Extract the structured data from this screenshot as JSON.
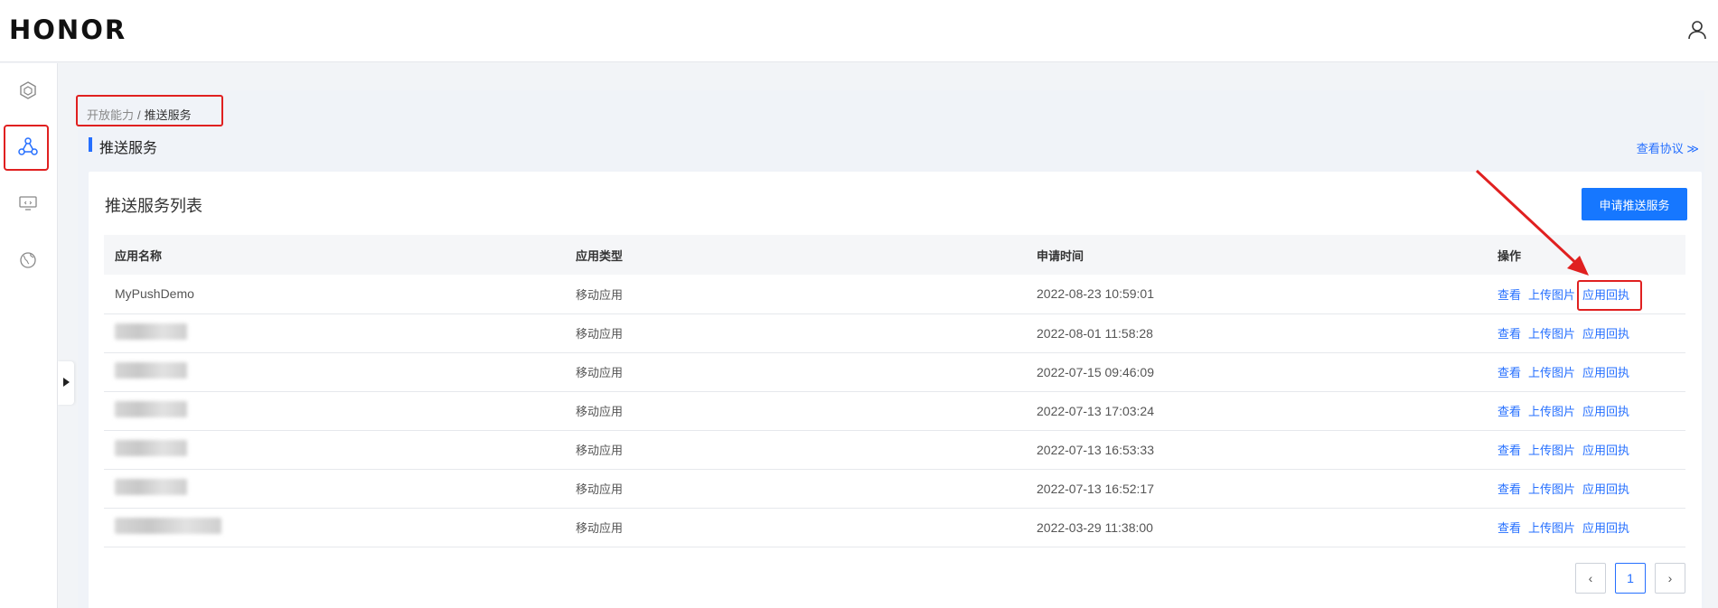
{
  "header": {
    "logo": "HONOR",
    "user_icon": "user-icon"
  },
  "sidebar": {
    "items": [
      {
        "icon": "cube-icon"
      },
      {
        "icon": "network-icon",
        "active": true
      },
      {
        "icon": "monitor-icon"
      },
      {
        "icon": "globe-icon"
      }
    ]
  },
  "breadcrumb": {
    "parent": "开放能力",
    "separator": "/",
    "current": "推送服务"
  },
  "page": {
    "title": "推送服务",
    "view_protocol": "查看协议 ≫"
  },
  "card": {
    "title": "推送服务列表",
    "apply_button": "申请推送服务",
    "columns": [
      "应用名称",
      "应用类型",
      "申请时间",
      "操作"
    ],
    "rows": [
      {
        "name": "MyPushDemo",
        "type": "移动应用",
        "time": "2022-08-23 10:59:01"
      },
      {
        "name": "",
        "type": "移动应用",
        "time": "2022-08-01 11:58:28"
      },
      {
        "name": "",
        "type": "移动应用",
        "time": "2022-07-15 09:46:09"
      },
      {
        "name": "",
        "type": "移动应用",
        "time": "2022-07-13 17:03:24"
      },
      {
        "name": "",
        "type": "移动应用",
        "time": "2022-07-13 16:53:33"
      },
      {
        "name": "",
        "type": "移动应用",
        "time": "2022-07-13 16:52:17"
      },
      {
        "name": "",
        "type": "移动应用",
        "time": "2022-03-29 11:38:00"
      }
    ],
    "actions": {
      "view": "查看",
      "upload": "上传图片",
      "receipt": "应用回执"
    }
  },
  "pagination": {
    "prev": "‹",
    "current": "1",
    "next": "›"
  },
  "colors": {
    "accent": "#256fff",
    "annotation": "#e02020"
  }
}
